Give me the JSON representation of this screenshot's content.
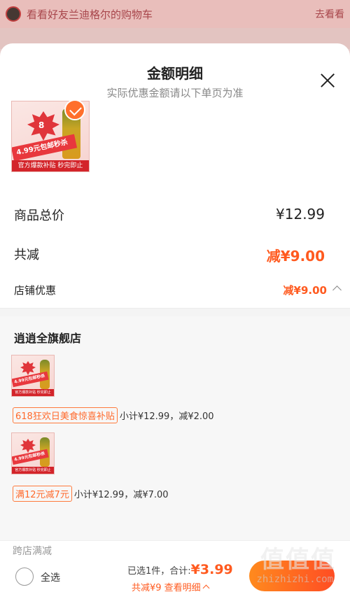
{
  "background": {
    "banner_text": "看看好友兰迪格尔的购物车",
    "banner_action": "去看看"
  },
  "sheet": {
    "title": "金额明细",
    "subtitle": "实际优惠金额请以下单页为准"
  },
  "product_thumb": {
    "burst_text": "8",
    "ribbon_text": "4.99元包邮秒杀",
    "bar_text": "官方爆款补贴 秒完即止"
  },
  "summary": {
    "total_price_label": "商品总价",
    "total_price_value": "¥12.99",
    "discount_label": "共减",
    "discount_value": "减¥9.00",
    "store_discount_label": "店铺优惠",
    "store_discount_value": "减¥9.00"
  },
  "store": {
    "name": "逍逍全旗舰店",
    "items": [
      {
        "promo_tag": "618狂欢日美食惊喜补贴",
        "detail": "小计¥12.99，减¥2.00"
      },
      {
        "promo_tag": "满12元减7元",
        "detail": "小计¥12.99，减¥7.00"
      }
    ]
  },
  "footer": {
    "peek_text": "跨店满减",
    "select_all_label": "全选",
    "selected_summary": "已选1件，合计:",
    "total": "¥3.99",
    "discount_detail": "共减¥9 查看明细",
    "watermark_logo": "值值值",
    "watermark_url": "zhizhizhi.com"
  },
  "colors": {
    "accent": "#ff5a1f",
    "accent_gradient_start": "#ff8a1e",
    "accent_gradient_end": "#ff4d23",
    "dim_background": "#f3d9d6"
  }
}
